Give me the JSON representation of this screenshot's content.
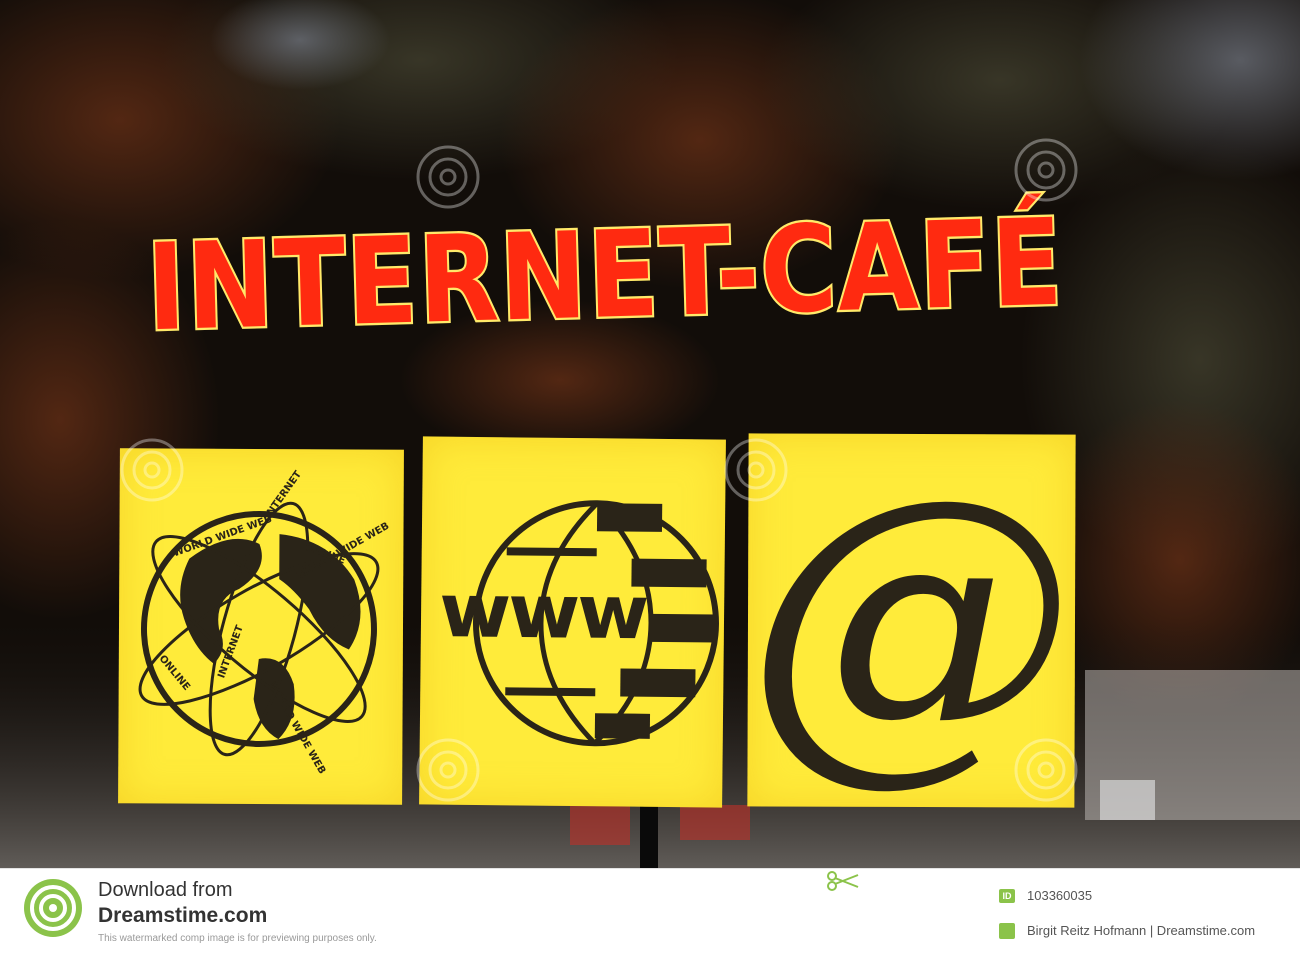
{
  "sign": {
    "title": "INTERNET-CAFÉ",
    "title_color": "#ff2a10",
    "outline_color": "#ffe96a",
    "panel_color": "#ffeb3a",
    "globe_band_words": [
      "WORLD WIDE WEB",
      "INTERNET",
      "ONLINE",
      "WORLD WIDE WEB",
      "INTERNET",
      "ONLINE",
      "WORLD WIDE WEB"
    ],
    "www_text": "www",
    "at_symbol": "@"
  },
  "watermark": {
    "text": "dreamstime"
  },
  "footer": {
    "download_line1": "Download from",
    "download_line2": "Dreamstime.com",
    "note": "This watermarked comp image is for previewing purposes only.",
    "id_label": "ID",
    "id_number": "103360035",
    "photographer": "Birgit Reitz Hofmann | Dreamstime.com",
    "accent_color": "#8bc34a"
  }
}
